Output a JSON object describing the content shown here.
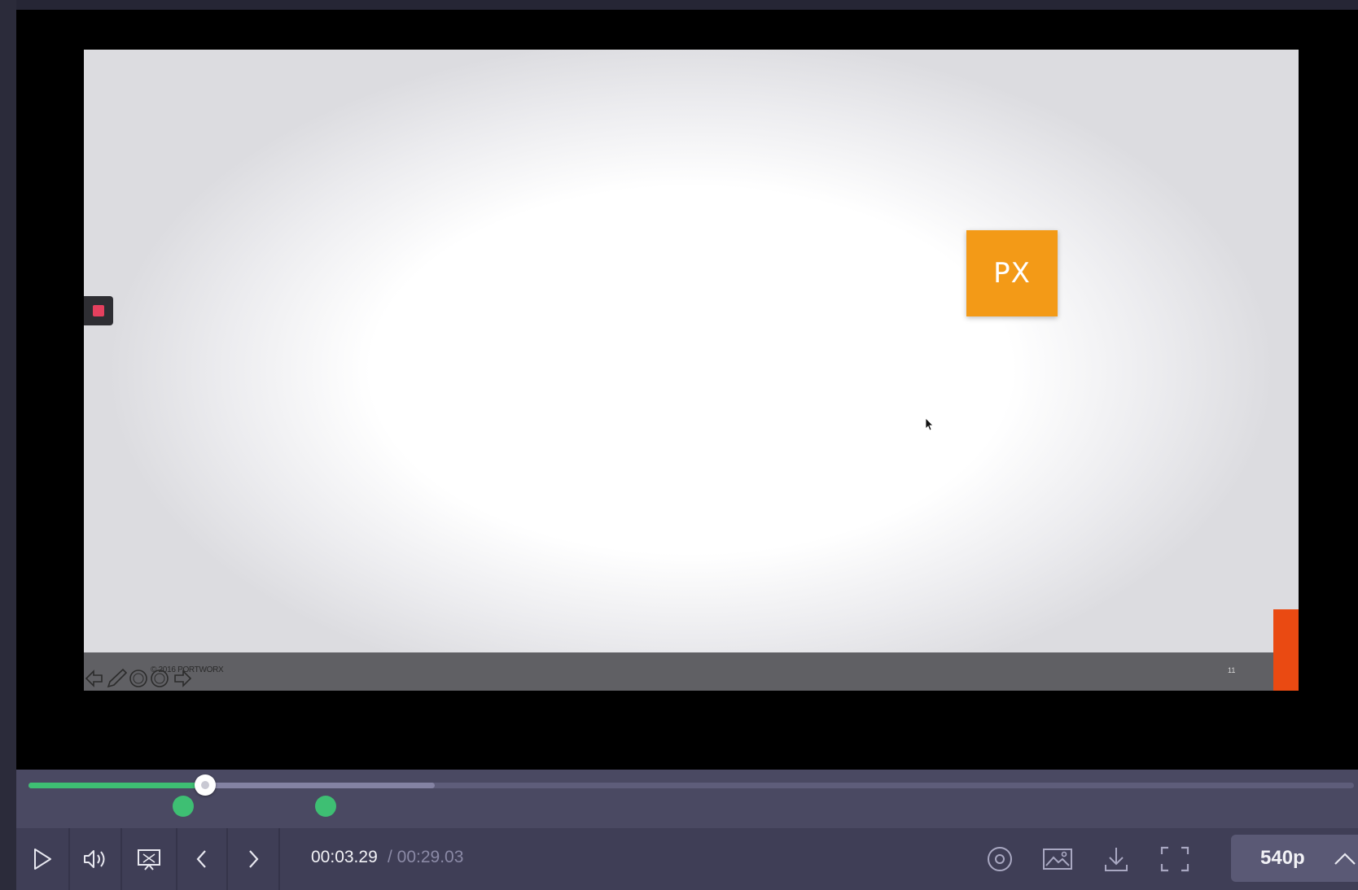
{
  "slide": {
    "logo_text": "PX",
    "copyright": "© 2016 PORTWORX",
    "page_number": "11",
    "colors": {
      "logo_bg": "#f39a17",
      "accent_bar": "#ea4a12",
      "record_marker": "#e5405e"
    }
  },
  "player": {
    "current_time": "00:03.29",
    "total_time": "/ 00:29.03",
    "quality": "540p",
    "progress_fraction": 0.1333,
    "buffered_fraction": 0.3066,
    "markers_fraction": [
      0.1165,
      0.2239
    ],
    "colors": {
      "played": "#3ebf73",
      "buffered": "#8483a3",
      "track": "#5e5d7a"
    },
    "icons": {
      "play": "play-icon",
      "volume": "volume-icon",
      "screen": "screen-icon",
      "prev": "chevron-left-icon",
      "next": "chevron-right-icon",
      "target": "target-icon",
      "image": "image-icon",
      "download": "download-icon",
      "fullscreen": "fullscreen-icon",
      "caret": "chevron-up-icon"
    }
  }
}
